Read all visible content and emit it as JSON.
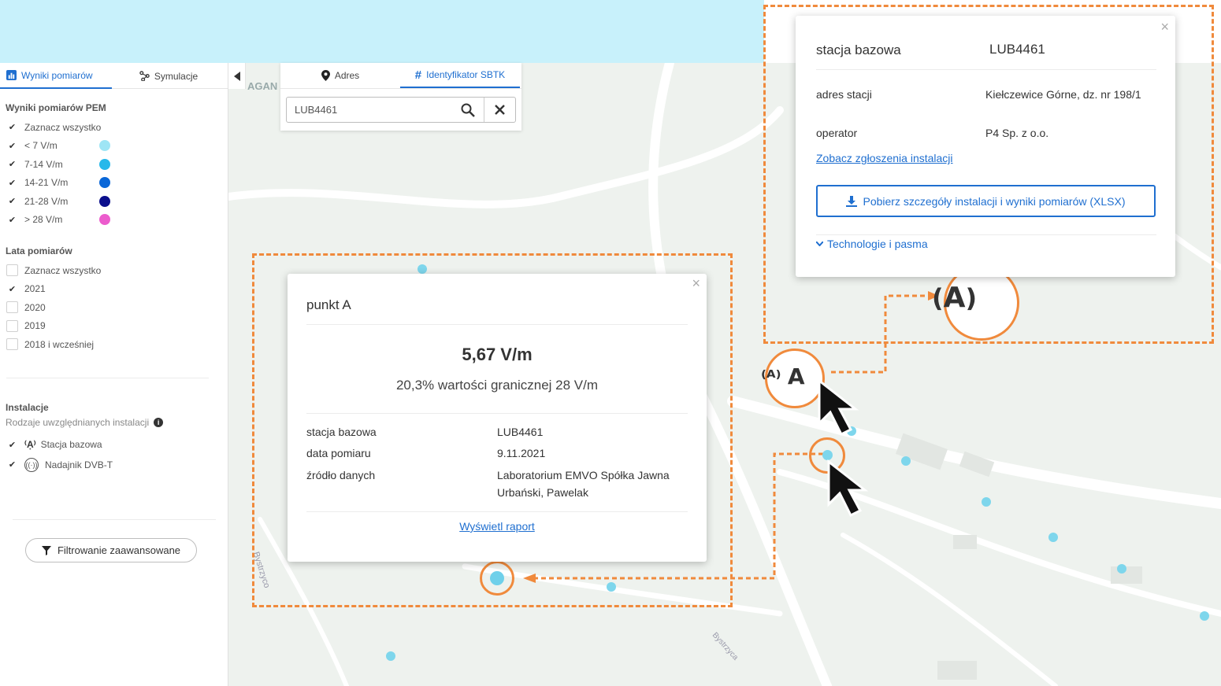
{
  "colors": {
    "accent": "#1f6fd0",
    "highlight": "#f08a3c",
    "lt7": "#9ee5f5",
    "c7_14": "#26b8ea",
    "c14_21": "#0a67d8",
    "c21_28": "#0b0f8c",
    "gt28": "#ec5ccd"
  },
  "sidebar": {
    "tabs": [
      {
        "label": "Wyniki pomiarów",
        "icon": "chart-icon"
      },
      {
        "label": "Symulacje",
        "icon": "simulation-icon"
      }
    ],
    "pem": {
      "title": "Wyniki pomiarów PEM",
      "items": [
        {
          "label": "Zaznacz wszystko",
          "checked": true
        },
        {
          "label": "< 7 V/m",
          "checked": true,
          "color": "#9ee5f5"
        },
        {
          "label": "7-14 V/m",
          "checked": true,
          "color": "#26b8ea"
        },
        {
          "label": "14-21 V/m",
          "checked": true,
          "color": "#0a67d8"
        },
        {
          "label": "21-28 V/m",
          "checked": true,
          "color": "#0b0f8c"
        },
        {
          "label": "> 28 V/m",
          "checked": true,
          "color": "#ec5ccd"
        }
      ]
    },
    "years": {
      "title": "Lata pomiarów",
      "items": [
        {
          "label": "Zaznacz wszystko",
          "checked": false
        },
        {
          "label": "2021",
          "checked": true
        },
        {
          "label": "2020",
          "checked": false
        },
        {
          "label": "2019",
          "checked": false
        },
        {
          "label": "2018 i wcześniej",
          "checked": false
        }
      ]
    },
    "installations": {
      "title": "Instalacje",
      "subtitle": "Rodzaje uwzględnianych instalacji",
      "items": [
        {
          "label": "Stacja bazowa",
          "checked": true
        },
        {
          "label": "Nadajnik DVB-T",
          "checked": true
        }
      ]
    },
    "filter_button": "Filtrowanie zaawansowane"
  },
  "search": {
    "tabs": [
      {
        "label": "Adres"
      },
      {
        "label": "Identyfikator SBTK"
      }
    ],
    "value": "LUB4461"
  },
  "map": {
    "label_fragment": "AGAN",
    "road1": "Bystrzyco",
    "road2": "Bystrzyca"
  },
  "point_popup": {
    "title": "punkt A",
    "value": "5,67 V/m",
    "percent": "20,3% wartości granicznej 28 V/m",
    "rows": [
      {
        "key": "stacja bazowa",
        "value": "LUB4461"
      },
      {
        "key": "data pomiaru",
        "value": "9.11.2021"
      },
      {
        "key": "źródło danych",
        "value": "Laboratorium EMVO Spółka Jawna Urbański, Pawelak"
      }
    ],
    "link": "Wyświetl raport"
  },
  "station_popup": {
    "title_key": "stacja bazowa",
    "title_value": "LUB4461",
    "rows": [
      {
        "key": "adres stacji",
        "value": "Kiełczewice Górne, dz. nr 198/1"
      },
      {
        "key": "operator",
        "value": "P4 Sp. z o.o."
      }
    ],
    "link": "Zobacz zgłoszenia instalacji",
    "download_button": "Pobierz szczegóły instalacji i wyniki pomiarów (XLSX)",
    "expander": "Technologie i pasma"
  }
}
